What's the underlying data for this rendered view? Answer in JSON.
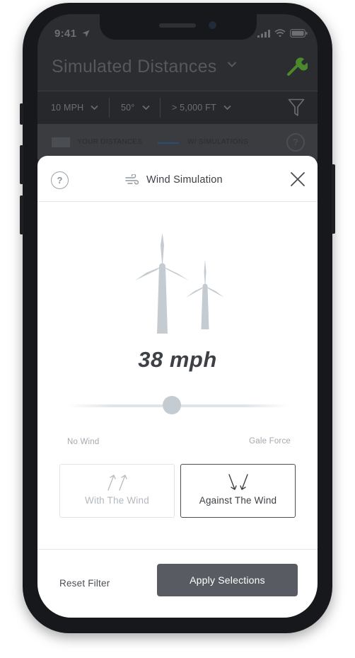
{
  "status_bar": {
    "time": "9:41"
  },
  "header": {
    "title": "Simulated Distances"
  },
  "filters": [
    {
      "label": "10 MPH"
    },
    {
      "label": "50°"
    },
    {
      "label": "> 5,000 FT"
    }
  ],
  "legend": {
    "your_distances": "YOUR DISTANCES",
    "with_simulations": "W/ SIMULATIONS"
  },
  "sheet": {
    "help_symbol": "?",
    "title": "Wind Simulation",
    "speed_label": "38 mph",
    "slider": {
      "min_label": "No Wind",
      "max_label": "Gale Force",
      "value": 0.47
    },
    "options": [
      {
        "label": "With The Wind",
        "selected": false
      },
      {
        "label": "Against The Wind",
        "selected": true
      }
    ],
    "reset_label": "Reset Filter",
    "apply_label": "Apply Selections"
  },
  "colors": {
    "accent_icon": "#4b8a2a",
    "primary_button": "#585c62",
    "turbine": "#c4ccd2"
  },
  "icons": {
    "signal": "signal-icon",
    "wifi": "wifi-icon",
    "battery": "battery-icon",
    "location": "location-arrow-icon",
    "tools": "wrench-icon",
    "filter": "funnel-icon",
    "wind": "wind-icon",
    "close": "close-icon"
  }
}
